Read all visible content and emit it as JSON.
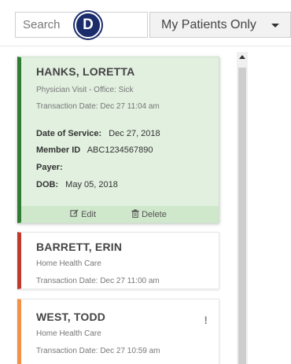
{
  "search": {
    "placeholder": "Search",
    "value": ""
  },
  "badge": {
    "letter": "D"
  },
  "filter": {
    "selected": "My Patients Only"
  },
  "patients": [
    {
      "name": "HANKS, LORETTA",
      "type": "Physician Visit - Office: Sick",
      "transaction": "Transaction Date: Dec 27 11:04 am",
      "date_of_service_label": "Date of Service:",
      "date_of_service": "Dec 27, 2018",
      "member_id_label": "Member ID",
      "member_id": "ABC1234567890",
      "payer_label": "Payer:",
      "payer": "",
      "dob_label": "DOB:",
      "dob": "May 05, 2018",
      "edit_label": "Edit",
      "delete_label": "Delete",
      "status_color": "#2e7d32"
    },
    {
      "name": "BARRETT, ERIN",
      "type": "Home Health Care",
      "transaction": "Transaction Date: Dec 27 11:00 am",
      "status_color": "#c0392b"
    },
    {
      "name": "WEST, TODD",
      "type": "Home Health Care",
      "transaction": "Transaction Date: Dec 27 10:59 am",
      "flag": "!",
      "status_color": "#f39147"
    }
  ]
}
